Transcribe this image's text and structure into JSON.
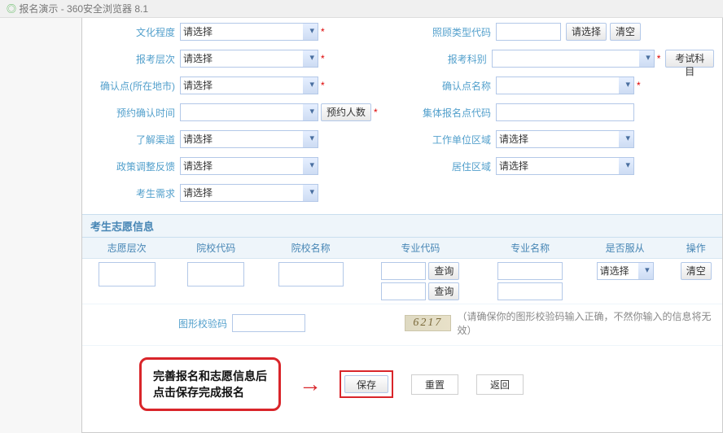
{
  "window": {
    "title": "报名演示 - 360安全浏览器 8.1"
  },
  "form": {
    "left": {
      "edu": {
        "label": "文化程度",
        "placeholder": "请选择"
      },
      "level": {
        "label": "报考层次",
        "placeholder": "请选择"
      },
      "confirm": {
        "label": "确认点(所在地市)",
        "placeholder": "请选择"
      },
      "reserve": {
        "label": "预约确认时间",
        "btn": "预约人数"
      },
      "channel": {
        "label": "了解渠道",
        "placeholder": "请选择"
      },
      "policy": {
        "label": "政策调整反馈",
        "placeholder": "请选择"
      },
      "demand": {
        "label": "考生需求",
        "placeholder": "请选择"
      }
    },
    "right": {
      "care": {
        "label": "照顾类型代码",
        "btn1": "请选择",
        "btn2": "清空"
      },
      "subject": {
        "label": "报考科别",
        "btn1": "考试科目"
      },
      "confirm_name": {
        "label": "确认点名称"
      },
      "group": {
        "label": "集体报名点代码"
      },
      "work": {
        "label": "工作单位区域",
        "placeholder": "请选择"
      },
      "live": {
        "label": "居住区域",
        "placeholder": "请选择"
      }
    }
  },
  "wish": {
    "title": "考生志愿信息",
    "headers": {
      "c1": "志愿层次",
      "c2": "院校代码",
      "c3": "院校名称",
      "c4": "专业代码",
      "c5": "专业名称",
      "c6": "是否服从",
      "c7": "操作"
    },
    "query": "查询",
    "obey_placeholder": "请选择",
    "clear": "清空"
  },
  "captcha": {
    "label": "图形校验码",
    "code": "6217",
    "hint": "（请确保你的图形校验码输入正确，不然你输入的信息将无效）"
  },
  "callout": {
    "line1": "完善报名和志愿信息后",
    "line2": "点击保存完成报名"
  },
  "actions": {
    "save": "保存",
    "reset": "重置",
    "back": "返回"
  }
}
